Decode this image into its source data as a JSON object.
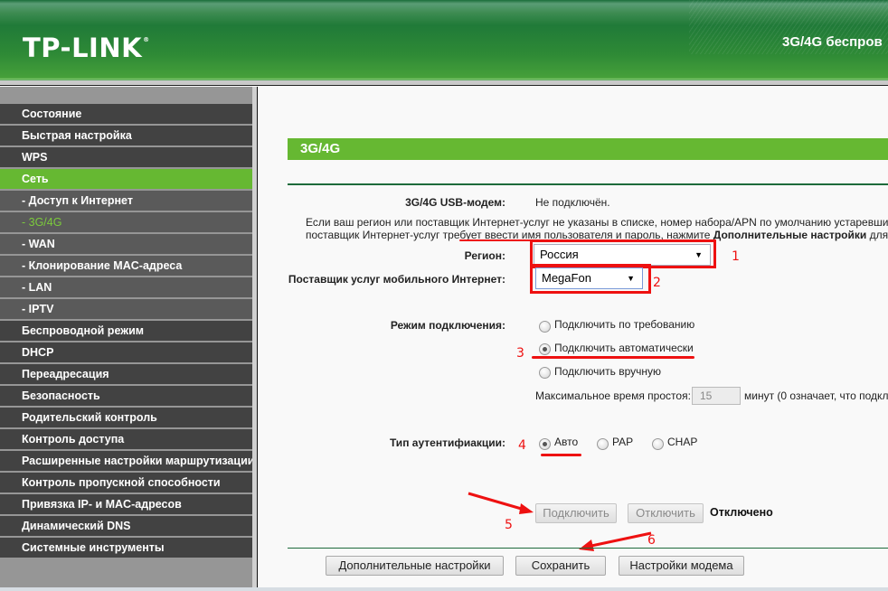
{
  "header": {
    "logo": "TP-LINK",
    "logo_mark": "®",
    "title": "3G/4G беспров"
  },
  "sidebar": {
    "items": [
      {
        "label": "Состояние",
        "type": "top"
      },
      {
        "label": "Быстрая настройка",
        "type": "top"
      },
      {
        "label": "WPS",
        "type": "top"
      },
      {
        "label": "Сеть",
        "type": "active-parent"
      },
      {
        "label": "- Доступ к Интернет",
        "type": "sub"
      },
      {
        "label": "- 3G/4G",
        "type": "active-child"
      },
      {
        "label": "- WAN",
        "type": "sub"
      },
      {
        "label": "- Клонирование MAC-адреса",
        "type": "sub"
      },
      {
        "label": "- LAN",
        "type": "sub"
      },
      {
        "label": "- IPTV",
        "type": "sub"
      },
      {
        "label": "Беспроводной режим",
        "type": "top"
      },
      {
        "label": "DHCP",
        "type": "top"
      },
      {
        "label": "Переадресация",
        "type": "top"
      },
      {
        "label": "Безопасность",
        "type": "top"
      },
      {
        "label": "Родительский контроль",
        "type": "top"
      },
      {
        "label": "Контроль доступа",
        "type": "top"
      },
      {
        "label": "Расширенные настройки маршрутизации",
        "type": "top"
      },
      {
        "label": "Контроль пропускной способности",
        "type": "top"
      },
      {
        "label": "Привязка IP- и MAC-адресов",
        "type": "top"
      },
      {
        "label": "Динамический DNS",
        "type": "top"
      },
      {
        "label": "Системные инструменты",
        "type": "top"
      }
    ]
  },
  "main": {
    "section_title": "3G/4G",
    "modem_label": "3G/4G USB-модем:",
    "modem_status": "Не подключён.",
    "info_line1": "Если ваш регион или поставщик Интернет-услуг не указаны в списке, номер набора/APN по умолчанию устаревши",
    "info_line2_prefix": "поставщик Интернет-услуг требует ввести имя пользователя и пароль, нажмите ",
    "info_line2_bold": "Дополнительные настройки",
    "info_line2_suffix": " для",
    "region_label": "Регион:",
    "region_value": "Россия",
    "provider_label": "Поставщик услуг мобильного Интернет:",
    "provider_value": "MegaFon",
    "mode_label": "Режим подключения:",
    "mode_options": [
      {
        "label": "Подключить по требованию",
        "checked": false
      },
      {
        "label": "Подключить автоматически",
        "checked": true
      },
      {
        "label": "Подключить вручную",
        "checked": false
      }
    ],
    "idle_label": "Максимальное время простоя:",
    "idle_value": "15",
    "idle_suffix": "минут (0 означает, что подкл",
    "auth_label": "Тип аутентифиакции:",
    "auth_options": [
      {
        "label": "Авто",
        "checked": true
      },
      {
        "label": "PAP",
        "checked": false
      },
      {
        "label": "CHAP",
        "checked": false
      }
    ],
    "connect_button": "Подключить",
    "disconnect_button": "Отключить",
    "connection_status": "Отключено",
    "advanced_button": "Дополнительные настройки",
    "save_button": "Сохранить",
    "modem_settings_button": "Настройки модема"
  },
  "annotations": {
    "color": "#ee1111",
    "numbers": [
      "1",
      "2",
      "3",
      "4",
      "5",
      "6"
    ]
  },
  "colors": {
    "brand_green": "#66b832",
    "menu_dark": "#424242",
    "menu_sub": "#5a5a5a",
    "active_text": "#7ccb3c"
  }
}
